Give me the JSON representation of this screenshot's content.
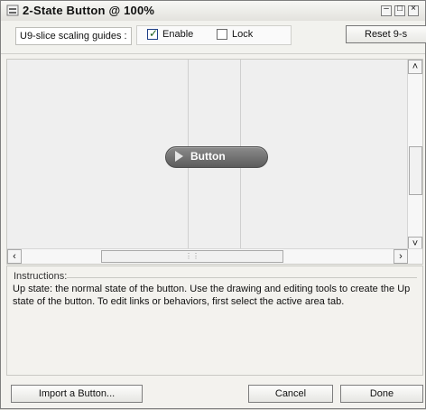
{
  "window": {
    "title": "2-State Button @ 100%",
    "controls": [
      "minimize",
      "maximize",
      "close"
    ]
  },
  "toolbar": {
    "label": "U9-slice scaling guides :",
    "enable_label": "Enable",
    "enable_checked": true,
    "lock_label": "Lock",
    "lock_checked": false,
    "reset_label": "Reset 9-s"
  },
  "stage": {
    "button_label": "Button"
  },
  "instructions": {
    "heading": "Instructions:",
    "text": "Up state: the normal state of the button. Use the drawing and editing tools to create the Up state of the button. To edit links or behaviors, first select the active area tab."
  },
  "buttons": {
    "import": "Import a Button...",
    "cancel": "Cancel",
    "done": "Done"
  },
  "icons": {
    "app": "button-editor-icon",
    "scroll_up": "scroll-up-arrow-icon",
    "scroll_down": "scroll-down-arrow-icon",
    "scroll_left": "scroll-left-arrow-icon",
    "scroll_right": "scroll-right-arrow-icon"
  }
}
